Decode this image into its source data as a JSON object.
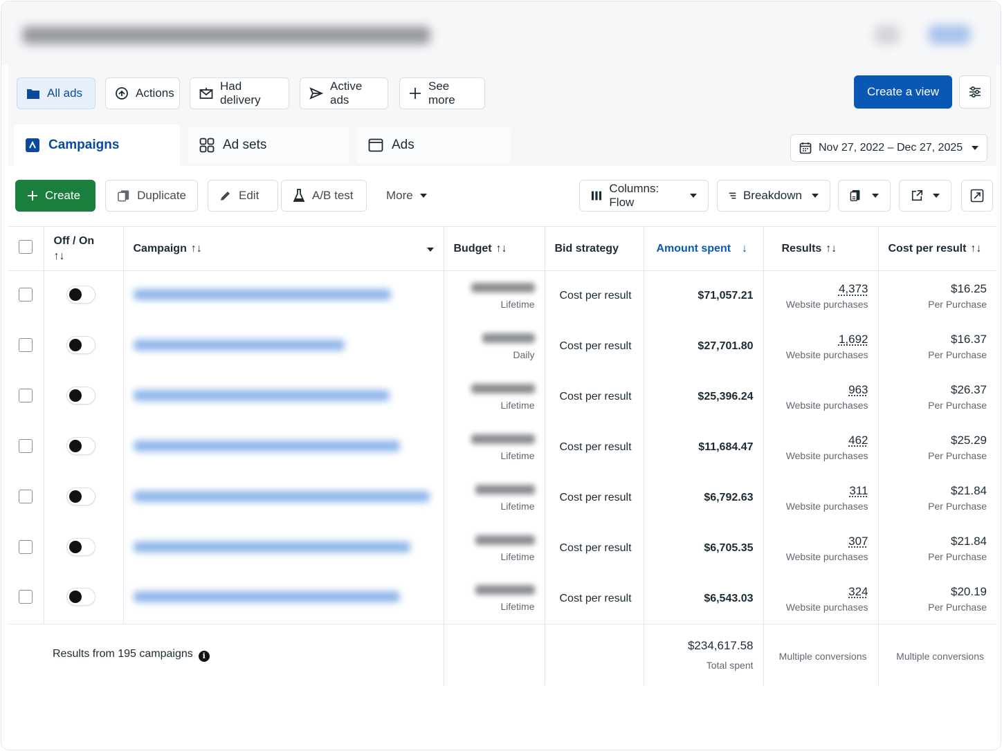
{
  "filters": {
    "all_ads": "All ads",
    "actions": "Actions",
    "had_delivery": "Had delivery",
    "active_ads": "Active ads",
    "see_more": "See more",
    "create_view": "Create a view"
  },
  "tabs": {
    "campaigns": "Campaigns",
    "ad_sets": "Ad sets",
    "ads": "Ads"
  },
  "date_range": "Nov 27, 2022 – Dec 27, 2025",
  "toolbar": {
    "create": "Create",
    "duplicate": "Duplicate",
    "edit": "Edit",
    "ab_test": "A/B test",
    "more": "More",
    "columns": "Columns: Flow",
    "breakdown": "Breakdown"
  },
  "columns": {
    "off_on": "Off / On",
    "campaign": "Campaign",
    "budget": "Budget",
    "bid_strategy": "Bid strategy",
    "amount_spent": "Amount spent",
    "results": "Results",
    "cost_per_result": "Cost per result"
  },
  "rows": [
    {
      "budget_type": "Lifetime",
      "bid": "Cost per result",
      "spent": "$71,057.21",
      "results": "4,373",
      "results_label": "Website purchases",
      "cpr": "$16.25",
      "cpr_label": "Per Purchase"
    },
    {
      "budget_type": "Daily",
      "bid": "Cost per result",
      "spent": "$27,701.80",
      "results": "1,692",
      "results_label": "Website purchases",
      "cpr": "$16.37",
      "cpr_label": "Per Purchase"
    },
    {
      "budget_type": "Lifetime",
      "bid": "Cost per result",
      "spent": "$25,396.24",
      "results": "963",
      "results_label": "Website purchases",
      "cpr": "$26.37",
      "cpr_label": "Per Purchase"
    },
    {
      "budget_type": "Lifetime",
      "bid": "Cost per result",
      "spent": "$11,684.47",
      "results": "462",
      "results_label": "Website purchases",
      "cpr": "$25.29",
      "cpr_label": "Per Purchase"
    },
    {
      "budget_type": "Lifetime",
      "bid": "Cost per result",
      "spent": "$6,792.63",
      "results": "311",
      "results_label": "Website purchases",
      "cpr": "$21.84",
      "cpr_label": "Per Purchase"
    },
    {
      "budget_type": "Lifetime",
      "bid": "Cost per result",
      "spent": "$6,705.35",
      "results": "307",
      "results_label": "Website purchases",
      "cpr": "$21.84",
      "cpr_label": "Per Purchase"
    },
    {
      "budget_type": "Lifetime",
      "bid": "Cost per result",
      "spent": "$6,543.03",
      "results": "324",
      "results_label": "Website purchases",
      "cpr": "$20.19",
      "cpr_label": "Per Purchase"
    }
  ],
  "footer": {
    "results_from": "Results from 195 campaigns",
    "total_spent": "$234,617.58",
    "total_spent_label": "Total spent",
    "results_multi": "Multiple conversions",
    "cpr_multi": "Multiple conversions"
  },
  "colors": {
    "primary": "#0a58b5",
    "create_green": "#1a7f3c",
    "active_tab_text": "#0a4a9c"
  }
}
